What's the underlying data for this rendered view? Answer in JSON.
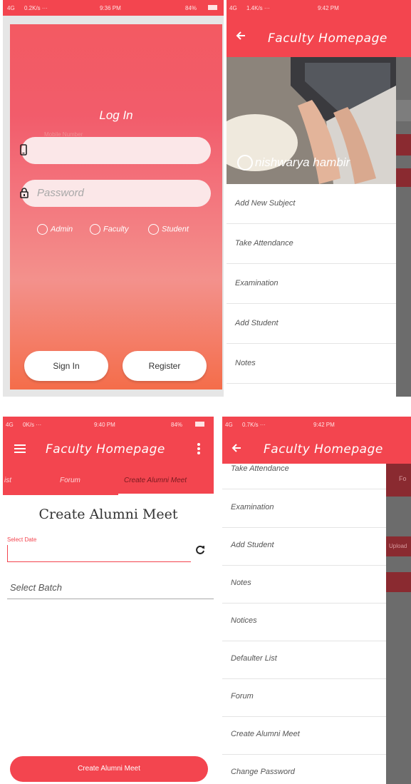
{
  "p1": {
    "status": {
      "left": "4G",
      "speed": "0.2K/s ···",
      "time": "9:36 PM",
      "battery": "84%"
    },
    "login_title": "Log In",
    "mobile_hint": "Mobile Number",
    "password_placeholder": "Password",
    "roles": [
      "Admin",
      "Faculty",
      "Student"
    ],
    "sign_in_label": "Sign In",
    "register_label": "Register"
  },
  "p2": {
    "status": {
      "left": "4G",
      "speed": "1.4K/s ···",
      "time": "9:42 PM"
    },
    "title": "Faculty Homepage",
    "photo_caption": "nishwarya hambir",
    "menu": [
      "Add New Subject",
      "Take Attendance",
      "Examination",
      "Add Student",
      "Notes"
    ]
  },
  "p3": {
    "status": {
      "left": "4G",
      "speed": "0K/s ···",
      "time": "9:40 PM",
      "battery": "84%"
    },
    "title": "Faculty Homepage",
    "tabs": [
      "ist",
      "Forum",
      "Create Alumni Meet"
    ],
    "form_title": "Create Alumni Meet",
    "date_label": "Select Date",
    "batch_label": "Select Batch",
    "button_label": "Create Alumni Meet"
  },
  "p4": {
    "status": {
      "left": "4G",
      "speed": "0.7K/s ···",
      "time": "9:42 PM"
    },
    "title": "Faculty Homepage",
    "menu": [
      "Take Attendance",
      "Examination",
      "Add Student",
      "Notes",
      "Notices",
      "Defaulter List",
      "Forum",
      "Create Alumni Meet",
      "Change Password"
    ],
    "behind_label": "Fo",
    "behind_upload": "Upload"
  },
  "colors": {
    "accent": "#f3454f",
    "gradient_top": "#f35a62",
    "gradient_bottom": "#f46d4a"
  }
}
